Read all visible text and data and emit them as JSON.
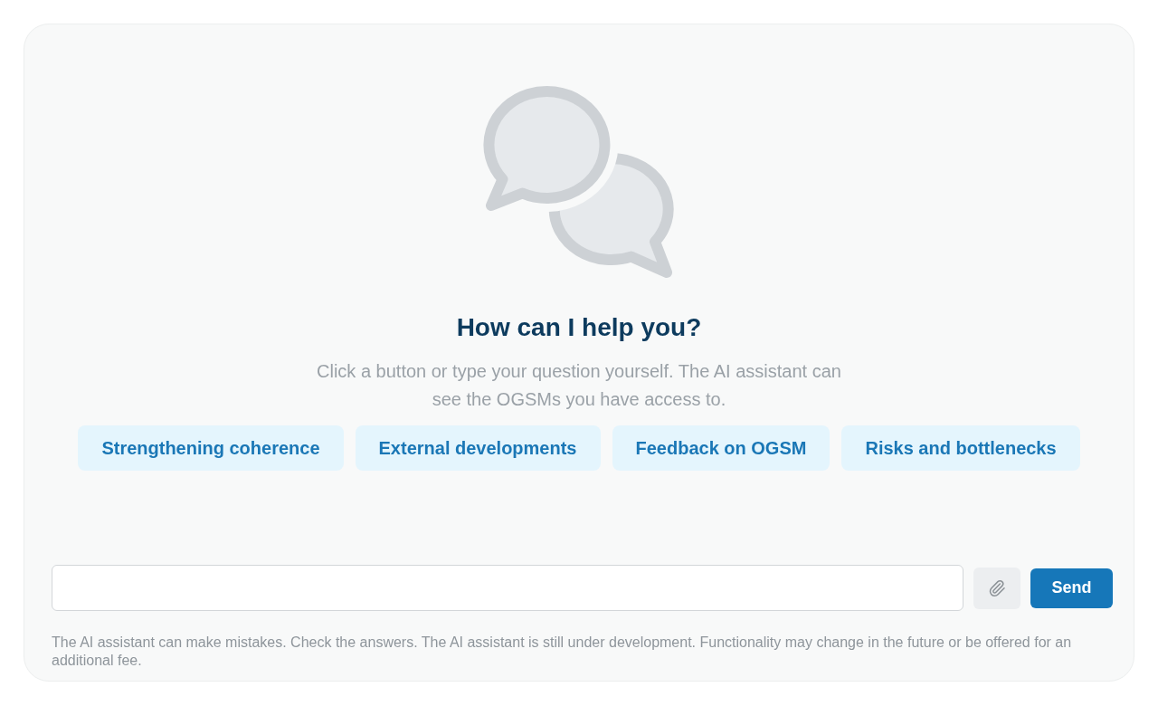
{
  "empty_state": {
    "heading": "How can I help you?",
    "subtitle": "Click a button or type your question yourself. The AI assistant can see the OGSMs you have access to."
  },
  "suggestions": [
    "Strengthening coherence",
    "External developments",
    "Feedback on OGSM",
    "Risks and bottlenecks"
  ],
  "composer": {
    "send_button": "Send"
  },
  "disclaimer": "The AI assistant can make mistakes. Check the answers. The AI assistant is still under development. Functionality may change in the future or be offered for an additional fee."
}
